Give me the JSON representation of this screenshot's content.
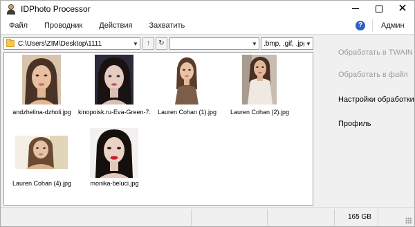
{
  "window": {
    "title": "IDPhoto Processor"
  },
  "menu": {
    "items": [
      "Файл",
      "Проводник",
      "Действия",
      "Захватить"
    ],
    "help": "?",
    "admin": "Админ"
  },
  "toolbar": {
    "path": "C:\\Users\\ZIM\\Desktop\\1111",
    "filter_value": "",
    "extensions": ".bmp, .gif, .jpg"
  },
  "files": [
    {
      "name": "andzhelina-dzholi.jpg"
    },
    {
      "name": "kinopoisk.ru-Eva-Green-7..."
    },
    {
      "name": "Lauren Cohan (1).jpg"
    },
    {
      "name": "Lauren Cohan (2).jpg"
    },
    {
      "name": "Lauren Cohan (4).jpg"
    },
    {
      "name": "monika-beluci.jpg"
    }
  ],
  "actions": {
    "twain": "Обработать в TWAIN",
    "to_file": "Обработать в файл",
    "settings": "Настройки обработки",
    "profile": "Профиль"
  },
  "status": {
    "disk_free": "165 GB"
  },
  "colors": {
    "accent": "#2a62c8",
    "disabled_text": "#9a9a9a"
  }
}
